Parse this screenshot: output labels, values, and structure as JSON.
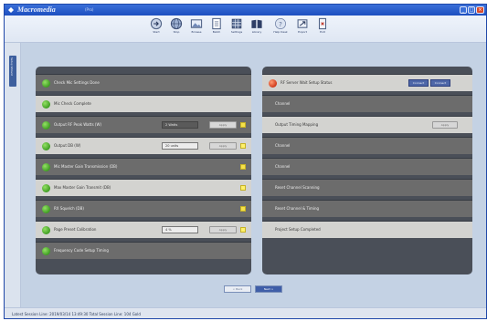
{
  "window": {
    "title": "Macromedia",
    "subtitle": "(Pro)",
    "controls": {
      "minimize": "_",
      "maximize": "□",
      "close": "×"
    }
  },
  "toolbar": {
    "items": [
      {
        "label": "Start",
        "icon": "circle-arrow-icon"
      },
      {
        "label": "Stop",
        "icon": "globe-icon"
      },
      {
        "label": "Browse",
        "icon": "image-icon"
      },
      {
        "label": "Batch",
        "icon": "document-icon"
      },
      {
        "label": "Settings",
        "icon": "grid-icon"
      },
      {
        "label": "Library",
        "icon": "book-icon"
      },
      {
        "label": "Help Desk",
        "icon": "help-icon"
      },
      {
        "label": "Export",
        "icon": "export-icon"
      },
      {
        "label": "Exit",
        "icon": "exit-icon"
      }
    ]
  },
  "sidebar": {
    "tab_label": "Setup Wizard"
  },
  "left_panel": {
    "rows": [
      {
        "name": "Check Mic Settings Done",
        "style": "dark",
        "icon": "green"
      },
      {
        "name": "Mic Check Complete",
        "style": "light",
        "icon": "green"
      },
      {
        "name": "Output RF Peak Watts (W)",
        "style": "dark",
        "icon": "green",
        "value": "2 Watts",
        "button": "Apply",
        "led": "yellow"
      },
      {
        "name": "Output DB (W)",
        "style": "light",
        "icon": "green",
        "value": "20 units",
        "button": "Apply",
        "led": "yellow-light"
      },
      {
        "name": "Mic Master Gain Transmission (DB)",
        "style": "dark",
        "icon": "green",
        "led": "yellow"
      },
      {
        "name": "Max Master Gain Transmit (DB)",
        "style": "light",
        "icon": "green",
        "led": "yellow-light"
      },
      {
        "name": "RX Squelch (DB)",
        "style": "dark",
        "icon": "green",
        "led": "yellow"
      },
      {
        "name": "Page Preset Calibration",
        "style": "light",
        "icon": "green",
        "value": "4 %",
        "button": "Apply",
        "led": "yellow-light"
      },
      {
        "name": "Frequency Code Setup Timing",
        "style": "dark",
        "icon": "green"
      }
    ]
  },
  "right_panel": {
    "rows": [
      {
        "name": "RF Server Wait Setup Status",
        "style": "light",
        "icon": "red",
        "buttons": [
          "Connect",
          "Connect"
        ]
      },
      {
        "name": "Channel",
        "style": "dark"
      },
      {
        "name": "Output Timing Mapping",
        "style": "light",
        "button": "Apply"
      },
      {
        "name": "Channel",
        "style": "dark"
      },
      {
        "name": "Channel",
        "style": "dark"
      },
      {
        "name": "Reset Channel Scanning",
        "style": "dark"
      },
      {
        "name": "Reset Channel & Timing",
        "style": "dark"
      },
      {
        "name": "Project Setup Completed",
        "style": "light"
      }
    ]
  },
  "footer": {
    "prev_label": "< Back",
    "next_label": "Next >"
  },
  "status": {
    "text": "Latest Session Line: 2019/03/14 13:49:30    Total Session Line: 104 Gold"
  }
}
